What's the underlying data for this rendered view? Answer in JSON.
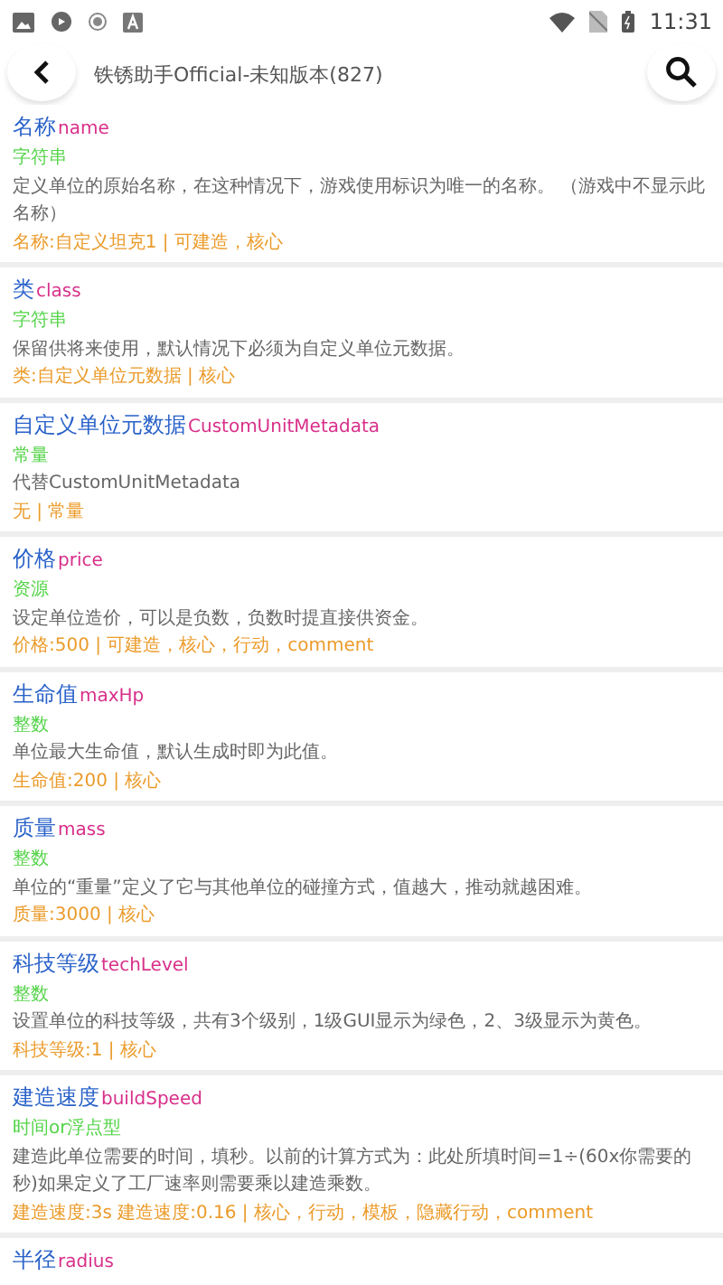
{
  "status_bar": {
    "time": "11:31"
  },
  "header": {
    "title": "铁锈助手Official-未知版本(827)"
  },
  "fields": [
    {
      "name": "名称",
      "key": "name",
      "type": "字符串",
      "description": "定义单位的原始名称，在这种情况下，游戏使用标识为唯一的名称。 （游戏中不显示此名称）",
      "usage": "名称:自定义坦克1 | 可建造，核心"
    },
    {
      "name": "类",
      "key": "class",
      "type": "字符串",
      "description": "保留供将来使用，默认情况下必须为自定义单位元数据。",
      "usage": "类:自定义单位元数据 | 核心"
    },
    {
      "name": "自定义单位元数据",
      "key": "CustomUnitMetadata",
      "type": "常量",
      "description": "代替CustomUnitMetadata",
      "usage": "无 | 常量"
    },
    {
      "name": "价格",
      "key": "price",
      "type": "资源",
      "description": "设定单位造价，可以是负数，负数时提直接供资金。",
      "usage": "价格:500 | 可建造，核心，行动，comment"
    },
    {
      "name": "生命值",
      "key": "maxHp",
      "type": "整数",
      "description": "单位最大生命值，默认生成时即为此值。",
      "usage": "生命值:200 | 核心"
    },
    {
      "name": "质量",
      "key": "mass",
      "type": "整数",
      "description": "单位的“重量”定义了它与其他单位的碰撞方式，值越大，推动就越困难。",
      "usage": "质量:3000 | 核心"
    },
    {
      "name": "科技等级",
      "key": "techLevel",
      "type": "整数",
      "description": "设置单位的科技等级，共有3个级别，1级GUI显示为绿色，2、3级显示为黄色。",
      "usage": "科技等级:1 | 核心"
    },
    {
      "name": "建造速度",
      "key": "buildSpeed",
      "type": "时间or浮点型",
      "description": "建造此单位需要的时间，填秒。以前的计算方式为：此处所填时间=1÷(60x你需要的秒)如果定义了工厂速率则需要乘以建造乘数。",
      "usage": "建造速度:3s 建造速度:0.16 | 核心，行动，模板，隐藏行动，comment"
    },
    {
      "name": "半径",
      "key": "radius"
    }
  ]
}
